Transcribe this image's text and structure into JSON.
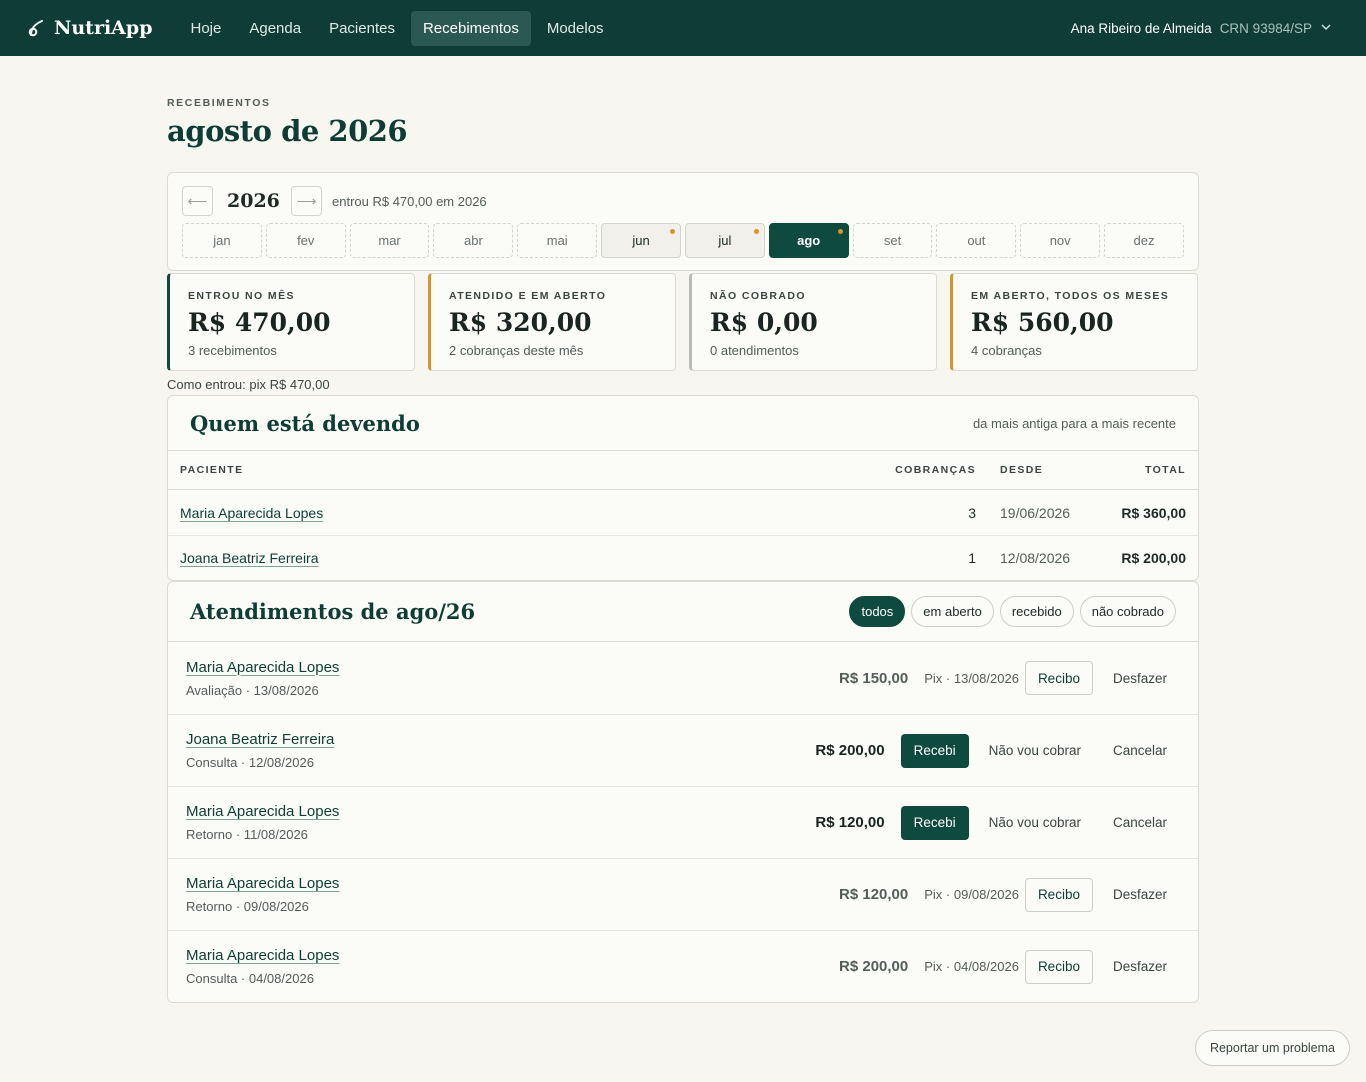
{
  "app": {
    "name": "NutriApp"
  },
  "nav": {
    "items": [
      {
        "label": "Hoje",
        "active": false
      },
      {
        "label": "Agenda",
        "active": false
      },
      {
        "label": "Pacientes",
        "active": false
      },
      {
        "label": "Recebimentos",
        "active": true
      },
      {
        "label": "Modelos",
        "active": false
      }
    ]
  },
  "user": {
    "name": "Ana Ribeiro de Almeida",
    "crn": "CRN 93984/SP"
  },
  "header": {
    "eyebrow": "RECEBIMENTOS",
    "title": "agosto de 2026"
  },
  "year_picker": {
    "year": "2026",
    "prev_icon": "arrow-left-icon",
    "next_icon": "arrow-right-icon",
    "note": "entrou R$ 470,00 em 2026",
    "months": [
      {
        "label": "jan",
        "state": "empty"
      },
      {
        "label": "fev",
        "state": "empty"
      },
      {
        "label": "mar",
        "state": "empty"
      },
      {
        "label": "abr",
        "state": "empty"
      },
      {
        "label": "mai",
        "state": "empty"
      },
      {
        "label": "jun",
        "state": "has",
        "dot": true
      },
      {
        "label": "jul",
        "state": "has",
        "dot": true
      },
      {
        "label": "ago",
        "state": "active",
        "dot": true
      },
      {
        "label": "set",
        "state": "empty"
      },
      {
        "label": "out",
        "state": "empty"
      },
      {
        "label": "nov",
        "state": "empty"
      },
      {
        "label": "dez",
        "state": "empty"
      }
    ]
  },
  "stats": [
    {
      "label": "ENTROU NO MÊS",
      "value": "R$ 470,00",
      "sub": "3 recebimentos",
      "accent": "#0f4a3f"
    },
    {
      "label": "ATENDIDO E EM ABERTO",
      "value": "R$ 320,00",
      "sub": "2 cobranças deste mês",
      "accent": "#d9942b"
    },
    {
      "label": "NÃO COBRADO",
      "value": "R$ 0,00",
      "sub": "0 atendimentos",
      "accent": "#b8bcb8"
    },
    {
      "label": "EM ABERTO, TODOS OS MESES",
      "value": "R$ 560,00",
      "sub": "4 cobranças",
      "accent": "#d9942b"
    }
  ],
  "como_entrou": "Como entrou: pix R$ 470,00",
  "owing": {
    "title": "Quem está devendo",
    "note": "da mais antiga para a mais recente",
    "columns": {
      "paciente": "PACIENTE",
      "cobrancas": "COBRANÇAS",
      "desde": "DESDE",
      "total": "TOTAL"
    },
    "rows": [
      {
        "paciente": "Maria Aparecida Lopes",
        "cobrancas": "3",
        "desde": "19/06/2026",
        "total": "R$ 360,00"
      },
      {
        "paciente": "Joana Beatriz Ferreira",
        "cobrancas": "1",
        "desde": "12/08/2026",
        "total": "R$ 200,00"
      }
    ]
  },
  "atendimentos": {
    "title": "Atendimentos de ago/26",
    "filters": [
      {
        "label": "todos",
        "active": true
      },
      {
        "label": "em aberto",
        "active": false
      },
      {
        "label": "recebido",
        "active": false
      },
      {
        "label": "não cobrado",
        "active": false
      }
    ],
    "rows": [
      {
        "name": "Maria Aparecida Lopes",
        "sub": "Avaliação · 13/08/2026",
        "amount": "R$ 150,00",
        "status": "paid",
        "meta": "Pix · 13/08/2026",
        "primary": "Recibo",
        "secondary": "Desfazer"
      },
      {
        "name": "Joana Beatriz Ferreira",
        "sub": "Consulta · 12/08/2026",
        "amount": "R$ 200,00",
        "status": "open",
        "primary": "Recebi",
        "middle": "Não vou cobrar",
        "secondary": "Cancelar"
      },
      {
        "name": "Maria Aparecida Lopes",
        "sub": "Retorno · 11/08/2026",
        "amount": "R$ 120,00",
        "status": "open",
        "primary": "Recebi",
        "middle": "Não vou cobrar",
        "secondary": "Cancelar"
      },
      {
        "name": "Maria Aparecida Lopes",
        "sub": "Retorno · 09/08/2026",
        "amount": "R$ 120,00",
        "status": "paid",
        "meta": "Pix · 09/08/2026",
        "primary": "Recibo",
        "secondary": "Desfazer"
      },
      {
        "name": "Maria Aparecida Lopes",
        "sub": "Consulta · 04/08/2026",
        "amount": "R$ 200,00",
        "status": "paid",
        "meta": "Pix · 04/08/2026",
        "primary": "Recibo",
        "secondary": "Desfazer"
      }
    ]
  },
  "report_button": "Reportar um problema"
}
